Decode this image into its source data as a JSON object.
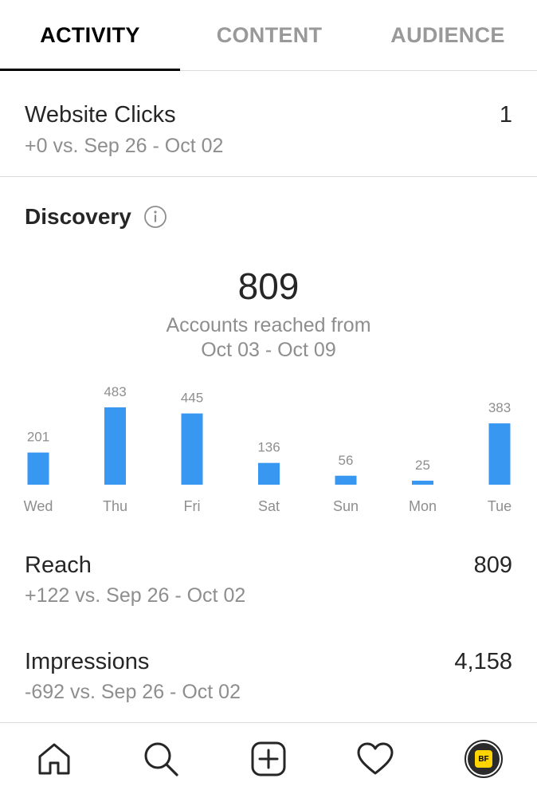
{
  "tabs": [
    {
      "label": "ACTIVITY",
      "active": true
    },
    {
      "label": "CONTENT",
      "active": false
    },
    {
      "label": "AUDIENCE",
      "active": false
    }
  ],
  "website_clicks": {
    "title": "Website Clicks",
    "value": "1",
    "comparison": "+0 vs. Sep 26 - Oct 02"
  },
  "discovery": {
    "title": "Discovery",
    "total": "809",
    "caption_line1": "Accounts reached from",
    "caption_line2": "Oct 03 - Oct 09"
  },
  "chart_data": {
    "type": "bar",
    "categories": [
      "Wed",
      "Thu",
      "Fri",
      "Sat",
      "Sun",
      "Mon",
      "Tue"
    ],
    "values": [
      201,
      483,
      445,
      136,
      56,
      25,
      383
    ],
    "bar_color": "#3897f0",
    "ylim": [
      0,
      483
    ]
  },
  "reach": {
    "title": "Reach",
    "value": "809",
    "comparison": "+122 vs. Sep 26 - Oct 02"
  },
  "impressions": {
    "title": "Impressions",
    "value": "4,158",
    "comparison": "-692 vs. Sep 26 - Oct 02"
  },
  "nav": {
    "items": [
      "home-icon",
      "search-icon",
      "new-post-icon",
      "heart-icon",
      "profile-avatar"
    ],
    "avatar_initials": "BF",
    "avatar_badge_color": "#ffd400"
  }
}
